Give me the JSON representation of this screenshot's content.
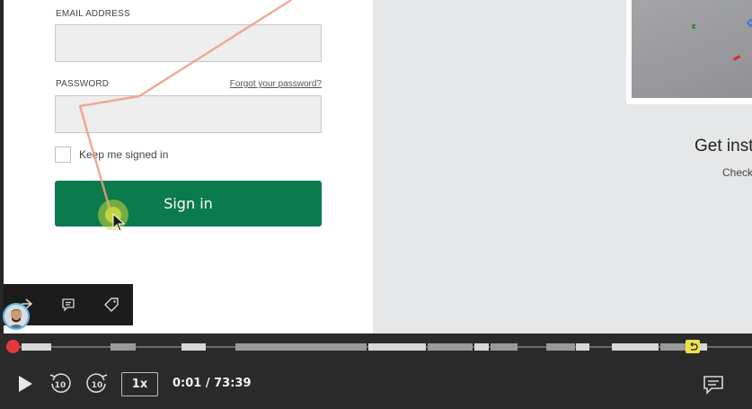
{
  "login": {
    "email_label": "EMAIL ADDRESS",
    "email_value": "",
    "password_label": "PASSWORD",
    "forgot_link": "Forgot your password?",
    "password_value": "",
    "keep_signed_in": "Keep me signed in",
    "keep_signed_in_checked": false,
    "signin_button": "Sign in"
  },
  "promo": {
    "heading": "Get inst",
    "subtext": "Check"
  },
  "annotation_toolbar": {
    "icons": [
      "share-icon",
      "comment-icon",
      "tag-icon"
    ]
  },
  "player": {
    "speed": "1x",
    "time": "0:01 / 73:39",
    "progress_fraction": 0.0002
  },
  "colors": {
    "signin_button": "#0b7a4d",
    "playhead": "#e8363d",
    "marker": "#f2e04a",
    "trail": "#ef9b83"
  }
}
